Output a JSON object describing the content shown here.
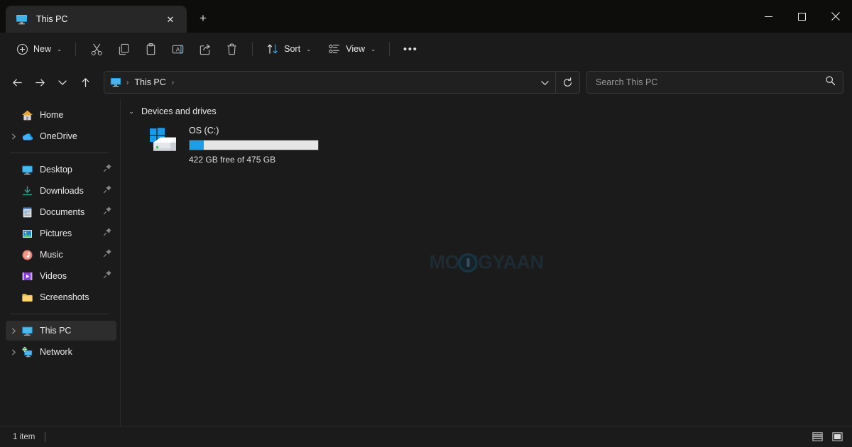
{
  "window": {
    "title": "This PC",
    "controls": {
      "minimize": "minimize-button",
      "maximize": "maximize-button",
      "close": "close-button"
    }
  },
  "tabs": {
    "items": [
      {
        "label": "This PC",
        "icon": "this-pc-icon",
        "active": true
      }
    ],
    "close_label": "✕",
    "new_tab_label": "+"
  },
  "toolbar": {
    "new_label": "New",
    "new_chevron": "⌄",
    "cut_label": "Cut",
    "copy_label": "Copy",
    "paste_label": "Paste",
    "rename_label": "Rename",
    "share_label": "Share",
    "delete_label": "Delete",
    "sort_label": "Sort",
    "sort_chevron": "⌄",
    "view_label": "View",
    "view_chevron": "⌄",
    "more_label": "•••"
  },
  "navigation": {
    "back_label": "←",
    "forward_label": "→",
    "recent_label": "⌄",
    "up_label": "↑",
    "breadcrumb": {
      "icon": "this-pc-icon",
      "lead_separator": "›",
      "items": [
        {
          "label": "This PC"
        }
      ],
      "trail_separator": "›"
    },
    "address_dropdown": "⌄",
    "refresh_label": "↻"
  },
  "search": {
    "placeholder": "Search This PC",
    "value": "",
    "icon": "search-icon"
  },
  "sidebar": {
    "items": [
      {
        "label": "Home",
        "icon": "home-icon",
        "expandable": false,
        "pinned": false,
        "selected": false,
        "indent": true
      },
      {
        "label": "OneDrive",
        "icon": "onedrive-icon",
        "expandable": true,
        "pinned": false,
        "selected": false,
        "indent": false
      },
      {
        "divider": true
      },
      {
        "label": "Desktop",
        "icon": "desktop-icon",
        "expandable": false,
        "pinned": true,
        "selected": false,
        "indent": true
      },
      {
        "label": "Downloads",
        "icon": "downloads-icon",
        "expandable": false,
        "pinned": true,
        "selected": false,
        "indent": true
      },
      {
        "label": "Documents",
        "icon": "documents-icon",
        "expandable": false,
        "pinned": true,
        "selected": false,
        "indent": true
      },
      {
        "label": "Pictures",
        "icon": "pictures-icon",
        "expandable": false,
        "pinned": true,
        "selected": false,
        "indent": true
      },
      {
        "label": "Music",
        "icon": "music-icon",
        "expandable": false,
        "pinned": true,
        "selected": false,
        "indent": true
      },
      {
        "label": "Videos",
        "icon": "videos-icon",
        "expandable": false,
        "pinned": true,
        "selected": false,
        "indent": true
      },
      {
        "label": "Screenshots",
        "icon": "folder-icon",
        "expandable": false,
        "pinned": false,
        "selected": false,
        "indent": true
      },
      {
        "divider": true
      },
      {
        "label": "This PC",
        "icon": "this-pc-icon",
        "expandable": true,
        "pinned": false,
        "selected": true,
        "indent": false
      },
      {
        "label": "Network",
        "icon": "network-icon",
        "expandable": true,
        "pinned": false,
        "selected": false,
        "indent": false
      }
    ]
  },
  "main": {
    "group_header": {
      "label": "Devices and drives",
      "chevron": "⌄"
    },
    "drives": [
      {
        "name": "OS (C:)",
        "capacity_text": "422 GB free of 475 GB",
        "free_gb": 422,
        "total_gb": 475,
        "used_percent": 11,
        "icon": "windows-drive-icon",
        "bar_fill_color": "#1f9ee6",
        "bar_track_color": "#e6e6e6"
      }
    ],
    "watermark": {
      "text": "MOBIGYAAN"
    }
  },
  "statusbar": {
    "item_count": "1 item",
    "details_view_label": "details-view",
    "large_icons_view_label": "large-icons-view"
  },
  "colors": {
    "window_background": "#1b1b1b",
    "titlebar_background": "#0d0d0b",
    "tab_active_background": "#272727",
    "selection_background": "#2d2d2d",
    "accent_blue": "#1f9ee6",
    "text_primary": "#e8e8e8",
    "text_secondary": "#9a9a9a"
  }
}
